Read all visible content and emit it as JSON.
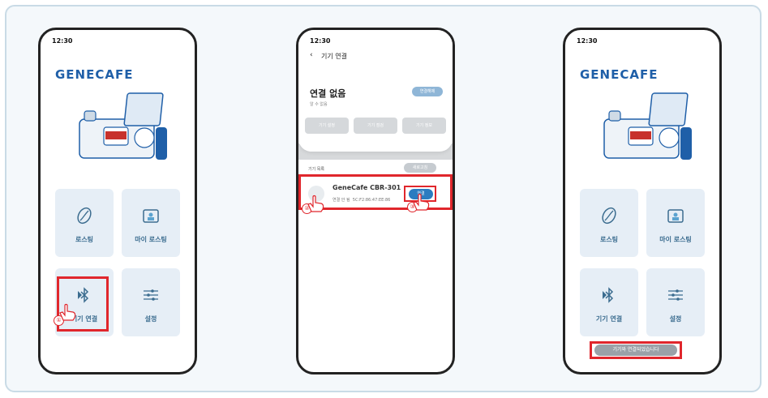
{
  "phone1": {
    "time": "12:30",
    "logo": "GENECAFE",
    "tiles": [
      {
        "label": "로스팅",
        "icon": "coffee-bean-icon"
      },
      {
        "label": "마이 로스팅",
        "icon": "folder-user-icon"
      },
      {
        "label": "기기 연결",
        "icon": "bluetooth-icon"
      },
      {
        "label": "설정",
        "icon": "sliders-icon"
      }
    ],
    "step_marker": "①"
  },
  "phone2": {
    "time": "12:30",
    "back_icon": "chevron-left-icon",
    "page_title": "기기 연결",
    "status_title": "연결 없음",
    "status_sub": "알 수 없음",
    "disconnect_label": "연결해제",
    "actions": [
      "기기 설정",
      "기기 점검",
      "기기 정보"
    ],
    "list_header": "기기 목록",
    "refresh_label": "새로고침",
    "device": {
      "name": "GeneCafe CBR-301",
      "status": "연결 안 됨",
      "mac": "5C:F2:86:47:EE:86",
      "connect_label": "연결"
    },
    "step_markers": [
      "②",
      "③"
    ]
  },
  "phone3": {
    "time": "12:30",
    "logo": "GENECAFE",
    "tiles": [
      {
        "label": "로스팅",
        "icon": "coffee-bean-icon"
      },
      {
        "label": "마이 로스팅",
        "icon": "folder-user-icon"
      },
      {
        "label": "기기 연결",
        "icon": "bluetooth-icon"
      },
      {
        "label": "설정",
        "icon": "sliders-icon"
      }
    ],
    "toast": "기기와 연결되었습니다"
  },
  "colors": {
    "accent": "#1f5fa8",
    "highlight": "#e0262c",
    "tile_bg": "#e6eef6",
    "tile_text": "#3b6c8f"
  }
}
